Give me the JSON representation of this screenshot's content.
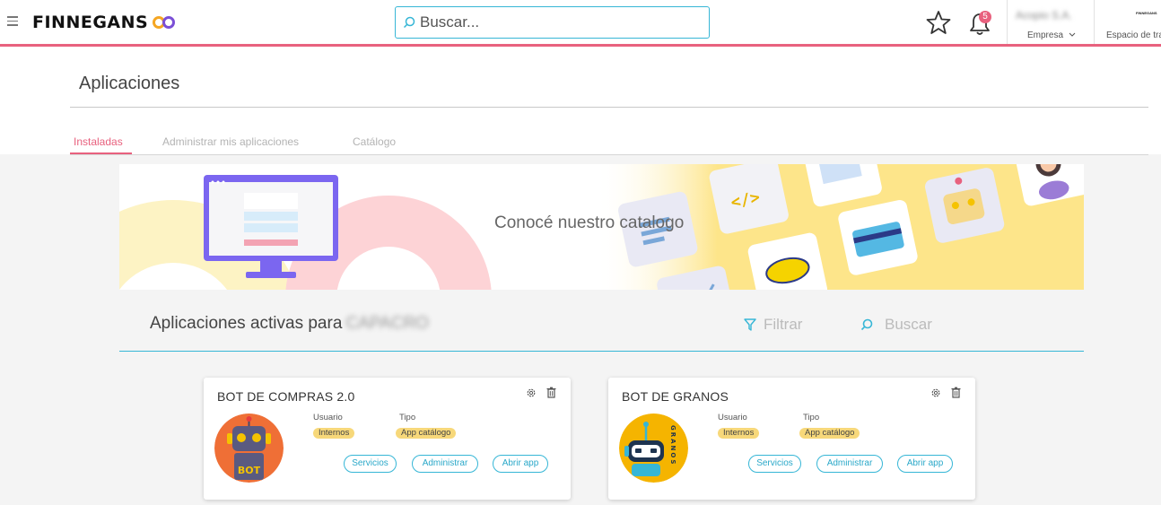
{
  "app": {
    "brand": "FINNEGANS",
    "search_placeholder": "Buscar...",
    "notification_count": "5",
    "company_name": "Acopio S.A.",
    "company_label": "Empresa",
    "workspace_mini": "FINNEGANS",
    "workspace_label": "Espacio de trabajo"
  },
  "page": {
    "title": "Aplicaciones",
    "tabs": [
      {
        "label": "Instaladas",
        "active": true
      },
      {
        "label": "Administrar mis aplicaciones",
        "active": false
      },
      {
        "label": "Catálogo",
        "active": false
      }
    ]
  },
  "banner": {
    "text": "Conocé nuestro catalogo"
  },
  "section": {
    "title": "Aplicaciones activas para",
    "company": "CAPACRO",
    "filter_label": "Filtrar",
    "search_label": "Buscar"
  },
  "cards": [
    {
      "title": "BOT DE COMPRAS 2.0",
      "user_label": "Usuario",
      "type_label": "Tipo",
      "user_value": "Internos",
      "type_value": "App catálogo",
      "logo_text": "BOT",
      "buttons": {
        "services": "Servicios",
        "admin": "Administrar",
        "open": "Abrir app"
      }
    },
    {
      "title": "BOT DE GRANOS",
      "user_label": "Usuario",
      "type_label": "Tipo",
      "user_value": "Internos",
      "type_value": "App catálogo",
      "logo_text": "GRANOS",
      "buttons": {
        "services": "Servicios",
        "admin": "Administrar",
        "open": "Abrir app"
      }
    }
  ],
  "colors": {
    "accent_pink": "#e8617e",
    "accent_cyan": "#36b6d6",
    "pill_yellow": "#f7d87a"
  },
  "icons": [
    "menu-icon",
    "search-icon",
    "star-icon",
    "bell-icon",
    "chevron-down-icon",
    "filter-icon",
    "gear-icon",
    "trash-icon"
  ]
}
